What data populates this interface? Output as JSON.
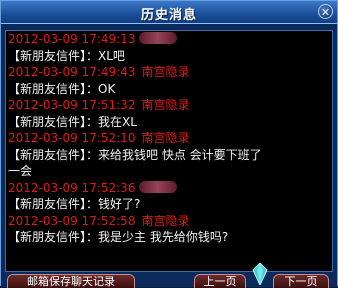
{
  "window": {
    "title": "历史消息",
    "close_glyph": "✕"
  },
  "messages": [
    {
      "time": "2012-03-09 17:49:13",
      "sender": "",
      "sender_blurred": true,
      "body": "【新朋友信件】：XL吧"
    },
    {
      "time": "2012-03-09 17:49:43",
      "sender": "南宫隐录",
      "sender_blurred": false,
      "body": "【新朋友信件】：OK"
    },
    {
      "time": "2012-03-09 17:51:32",
      "sender": "南宫隐录",
      "sender_blurred": false,
      "body": "【新朋友信件】：我在XL"
    },
    {
      "time": "2012-03-09 17:52:10",
      "sender": "南宫隐录",
      "sender_blurred": false,
      "body": "【新朋友信件】：来给我钱吧 快点 会计要下班了\n一会"
    },
    {
      "time": "2012-03-09 17:52:36",
      "sender": "",
      "sender_blurred": true,
      "body": "【新朋友信件】：钱好了?"
    },
    {
      "time": "2012-03-09 17:52:58",
      "sender": "南宫隐录",
      "sender_blurred": false,
      "body": "【新朋友信件】：我是少主 我先给你钱吗?"
    }
  ],
  "buttons": {
    "mail": "邮箱保存聊天记录",
    "prev": "上一页",
    "next": "下一页"
  },
  "colors": {
    "timestamp": "#e01818",
    "body_text": "#f2f2f2",
    "panel_bg": "#000000",
    "frame": "#0b2a5c"
  },
  "icons": {
    "close": "close-icon",
    "gem": "gem-icon"
  }
}
